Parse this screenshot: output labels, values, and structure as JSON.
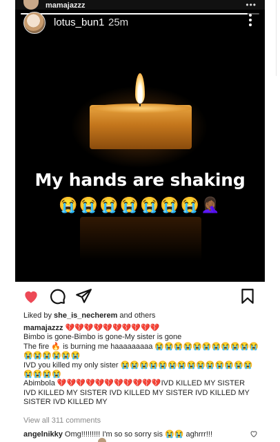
{
  "outer_post": {
    "username": "mamajazzz",
    "more_icon": "ellipsis-horizontal-icon"
  },
  "story": {
    "username": "lotus_bun1",
    "time": "25m",
    "progress": 0.95,
    "text": "My hands are shaking",
    "emojis": "😭😭😭😭😭😭😭🤦🏾‍♀️"
  },
  "actions": {
    "like_icon": "heart-filled-icon",
    "comment_icon": "comment-icon",
    "share_icon": "send-icon",
    "save_icon": "bookmark-icon",
    "like_color": "#ed4956"
  },
  "likes": {
    "prefix": "Liked by ",
    "user": "she_is_necherem",
    "suffix": " and others"
  },
  "caption": {
    "username": "mamajazzz",
    "text": " 💔💔💔💔💔💔💔💔💔💔\nBimbo is gone-Bimbo is gone-My sister is gone\nThe fire 🔥 is burning me haaaaaaaaa 😭😭😭😭😭😭😭😭😭😭😭😭😭😭😭😭😭\nIVD you killed my only sister 😭😭😭😭😭😭😭😭😭😭😭😭😭😭😭😭😭😭\nAbimbola 💔💔💔💔💔💔💔💔💔💔💔IVD KILLED MY SISTER IVD KILLED MY SISTER IVD KILLED MY SISTER IVD KILLED MY SISTER IVD KILLED MY"
  },
  "view_all": "View all 311 comments",
  "top_comment": {
    "username": "angelnikky",
    "text": " Omg!!!!!!!!! I'm so so sorry sis 😭😭 aghrrr!!!"
  }
}
